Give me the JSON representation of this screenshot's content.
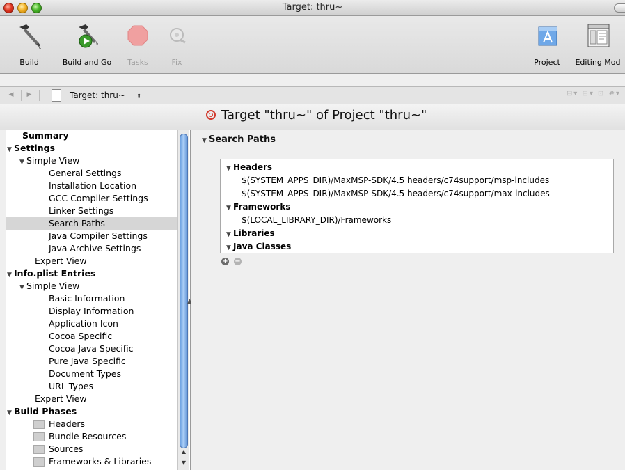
{
  "window": {
    "title": "Target: thru~"
  },
  "toolbar": {
    "build": "Build",
    "build_and_go": "Build and Go",
    "tasks": "Tasks",
    "fix": "Fix",
    "project": "Project",
    "editing_mode": "Editing Mod"
  },
  "navbar": {
    "target_popup": "Target: thru~"
  },
  "header": {
    "title": "Target \"thru~\" of Project \"thru~\""
  },
  "sidebar": {
    "items": [
      {
        "label": "Summary",
        "level": 0,
        "bold": true
      },
      {
        "label": "Settings",
        "level": 0,
        "bold": true,
        "disclosure": "open"
      },
      {
        "label": "Simple View",
        "level": 1,
        "disclosure": "open"
      },
      {
        "label": "General Settings",
        "level": 2
      },
      {
        "label": "Installation Location",
        "level": 2
      },
      {
        "label": "GCC Compiler Settings",
        "level": 2
      },
      {
        "label": "Linker Settings",
        "level": 2
      },
      {
        "label": "Search Paths",
        "level": 2,
        "selected": true
      },
      {
        "label": "Java Compiler Settings",
        "level": 2
      },
      {
        "label": "Java Archive Settings",
        "level": 2
      },
      {
        "label": "Expert View",
        "level": 1
      },
      {
        "label": "Info.plist Entries",
        "level": 0,
        "bold": true,
        "disclosure": "open"
      },
      {
        "label": "Simple View",
        "level": 1,
        "disclosure": "open"
      },
      {
        "label": "Basic Information",
        "level": 2
      },
      {
        "label": "Display Information",
        "level": 2
      },
      {
        "label": "Application Icon",
        "level": 2
      },
      {
        "label": "Cocoa Specific",
        "level": 2
      },
      {
        "label": "Cocoa Java Specific",
        "level": 2
      },
      {
        "label": "Pure Java Specific",
        "level": 2
      },
      {
        "label": "Document Types",
        "level": 2
      },
      {
        "label": "URL Types",
        "level": 2
      },
      {
        "label": "Expert View",
        "level": 1
      },
      {
        "label": "Build Phases",
        "level": 0,
        "bold": true,
        "disclosure": "open"
      },
      {
        "label": "Headers",
        "level": 1,
        "folder": true
      },
      {
        "label": "Bundle Resources",
        "level": 1,
        "folder": true
      },
      {
        "label": "Sources",
        "level": 1,
        "folder": true
      },
      {
        "label": "Frameworks & Libraries",
        "level": 1,
        "folder": true
      }
    ]
  },
  "search_paths": {
    "title": "Search Paths",
    "rows": [
      {
        "text": "Headers",
        "group": true
      },
      {
        "text": "$(SYSTEM_APPS_DIR)/MaxMSP-SDK/4.5 headers/c74support/msp-includes"
      },
      {
        "text": "$(SYSTEM_APPS_DIR)/MaxMSP-SDK/4.5 headers/c74support/max-includes"
      },
      {
        "text": "Frameworks",
        "group": true
      },
      {
        "text": "$(LOCAL_LIBRARY_DIR)/Frameworks"
      },
      {
        "text": "Libraries",
        "group": true
      },
      {
        "text": "Java Classes",
        "group": true
      }
    ],
    "add_symbol": "+",
    "remove_symbol": "−"
  },
  "colors": {
    "selection": "#d6d6d6",
    "scroll_thumb": "#6ea2e2",
    "target_icon": "#d23b2e"
  }
}
